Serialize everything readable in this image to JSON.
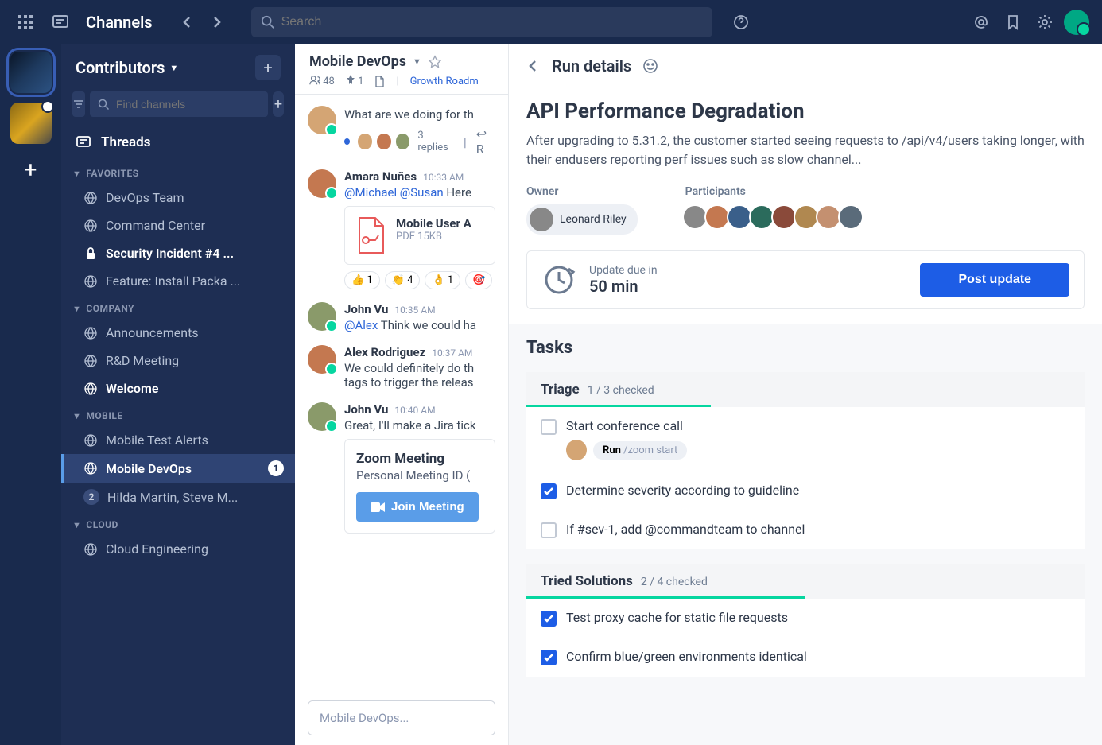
{
  "topbar": {
    "title": "Channels",
    "search_placeholder": "Search"
  },
  "team": {
    "name": "Contributors",
    "find_placeholder": "Find channels",
    "threads_label": "Threads"
  },
  "sections": {
    "favorites": {
      "label": "FAVORITES",
      "items": [
        {
          "label": "DevOps Team",
          "icon": "globe"
        },
        {
          "label": "Command Center",
          "icon": "globe"
        },
        {
          "label": "Security Incident #4 ...",
          "icon": "lock",
          "bold": true
        },
        {
          "label": "Feature: Install Packa ...",
          "icon": "globe"
        }
      ]
    },
    "company": {
      "label": "COMPANY",
      "items": [
        {
          "label": "Announcements",
          "icon": "globe"
        },
        {
          "label": "R&D Meeting",
          "icon": "globe"
        },
        {
          "label": "Welcome",
          "icon": "globe",
          "bold": true
        }
      ]
    },
    "mobile": {
      "label": "MOBILE",
      "items": [
        {
          "label": "Mobile Test Alerts",
          "icon": "globe"
        },
        {
          "label": "Mobile DevOps",
          "icon": "globe",
          "bold": true,
          "active": true,
          "badge": "1"
        },
        {
          "label": "Hilda Martin, Steve M...",
          "icon": "",
          "badge_gray": "2"
        }
      ]
    },
    "cloud": {
      "label": "CLOUD",
      "items": [
        {
          "label": "Cloud Engineering",
          "icon": "globe"
        }
      ]
    }
  },
  "channel": {
    "title": "Mobile DevOps",
    "members": "48",
    "pinned": "1",
    "link": "Growth Roadm"
  },
  "messages": [
    {
      "author": "",
      "text": "What are we doing for th",
      "thread": {
        "replies": "3 replies",
        "reply_icon": "R"
      }
    },
    {
      "author": "Amara Nuñes",
      "time": "10:33 AM",
      "mentions": "@Michael @Susan",
      "text_after": " Here",
      "attachment": {
        "title": "Mobile User A",
        "meta": "PDF 15KB"
      },
      "reactions": [
        {
          "emoji": "👍",
          "count": "1"
        },
        {
          "emoji": "👏",
          "count": "4"
        },
        {
          "emoji": "👌",
          "count": "1"
        },
        {
          "emoji": "🎯",
          "count": ""
        }
      ]
    },
    {
      "author": "John Vu",
      "time": "10:35 AM",
      "mentions": "@Alex",
      "text_after": " Think we could ha"
    },
    {
      "author": "Alex Rodriguez",
      "time": "10:37 AM",
      "text": "We could definitely do th tags to trigger the releas"
    },
    {
      "author": "John Vu",
      "time": "10:40 AM",
      "text": "Great, I'll make a Jira tick",
      "zoom": {
        "title": "Zoom Meeting",
        "sub": "Personal Meeting ID (",
        "button": "Join Meeting"
      }
    }
  ],
  "compose": {
    "placeholder": "Mobile DevOps..."
  },
  "run": {
    "header": "Run details",
    "title": "API Performance Degradation",
    "description": "After upgrading to 5.31.2, the customer started seeing requests to /api/v4/users taking longer, with their endusers reporting perf issues such as slow channel...",
    "owner_label": "Owner",
    "owner_name": "Leonard Riley",
    "participants_label": "Participants",
    "update_due_label": "Update due in",
    "update_time": "50 min",
    "post_button": "Post update",
    "tasks_label": "Tasks",
    "groups": [
      {
        "name": "Triage",
        "count": "1 / 3 checked",
        "class": "tg-triage",
        "items": [
          {
            "text": "Start conference call",
            "checked": false,
            "run_action": {
              "label": "Run",
              "cmd": "/zoom start"
            }
          },
          {
            "text": "Determine severity according to guideline",
            "checked": true
          },
          {
            "text": "If #sev-1, add @commandteam to channel",
            "checked": false
          }
        ]
      },
      {
        "name": "Tried Solutions",
        "count": "2 / 4 checked",
        "class": "tg-tried",
        "items": [
          {
            "text": "Test proxy cache for static file requests",
            "checked": true
          },
          {
            "text": "Confirm blue/green environments identical",
            "checked": true
          }
        ]
      }
    ]
  },
  "avatar_colors": [
    "#888",
    "#c47850",
    "#3a5f8a",
    "#2b6b5c",
    "#8a4a3a",
    "#b08850",
    "#c49070",
    "#5a6b7a"
  ]
}
